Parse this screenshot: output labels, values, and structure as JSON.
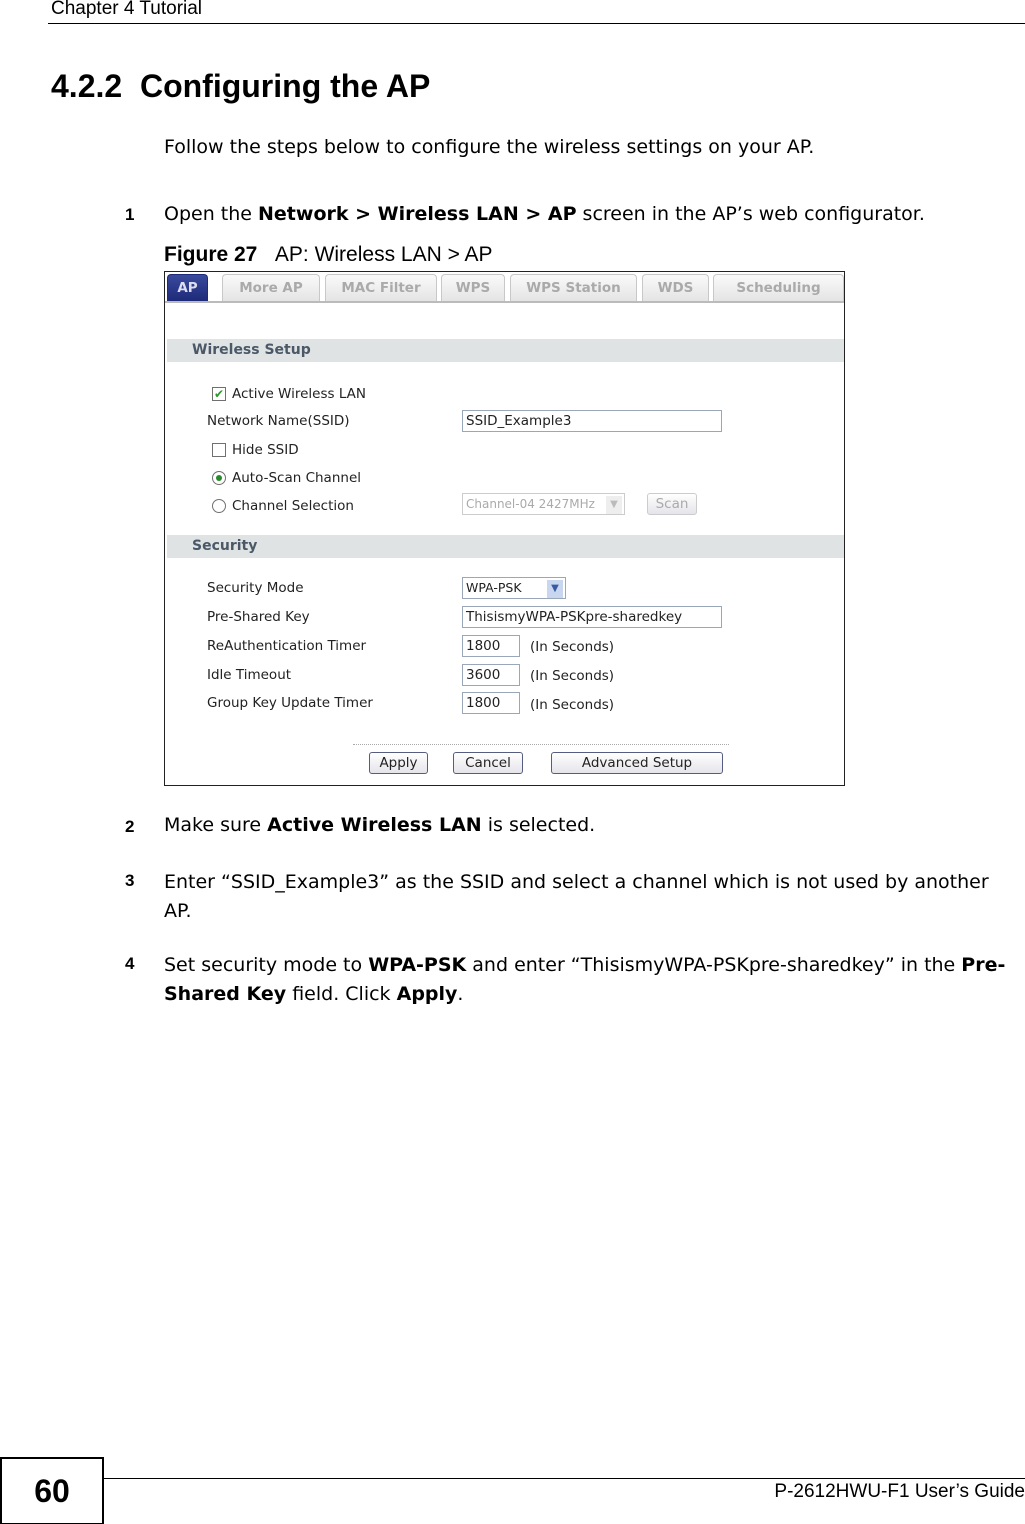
{
  "header": {
    "chapter": "Chapter 4 Tutorial"
  },
  "section": {
    "number": "4.2.2",
    "title": "Configuring the AP"
  },
  "intro": "Follow the steps below to configure the wireless settings on your AP.",
  "steps": [
    {
      "num": "1",
      "parts": [
        "Open the ",
        "Network > Wireless LAN > AP",
        " screen in the AP’s web configurator."
      ]
    },
    {
      "num": "2",
      "parts": [
        "Make sure ",
        "Active Wireless LAN",
        " is selected."
      ]
    },
    {
      "num": "3",
      "text": "Enter “SSID_Example3” as the SSID and select a channel which is not used by another AP."
    },
    {
      "num": "4",
      "parts": [
        "Set security mode to ",
        "WPA-PSK",
        " and enter “ThisismyWPA-PSKpre-sharedkey” in the ",
        "Pre-Shared Key",
        " field. Click ",
        "Apply",
        "."
      ]
    }
  ],
  "figure": {
    "label": "Figure 27",
    "caption": "AP: Wireless LAN > AP"
  },
  "screenshot": {
    "tabs": [
      "AP",
      "More AP",
      "MAC Filter",
      "WPS",
      "WPS Station",
      "WDS",
      "Scheduling"
    ],
    "active_tab": "AP",
    "wireless_setup": {
      "title": "Wireless Setup",
      "active_wireless_lan": {
        "label": "Active Wireless LAN",
        "checked": true
      },
      "ssid": {
        "label": "Network Name(SSID)",
        "value": "SSID_Example3"
      },
      "hide_ssid": {
        "label": "Hide SSID",
        "checked": false
      },
      "auto_scan": {
        "label": "Auto-Scan Channel",
        "selected": true
      },
      "channel_selection": {
        "label": "Channel Selection",
        "selected": false,
        "value": "Channel-04 2427MHz"
      },
      "scan_button": "Scan"
    },
    "security": {
      "title": "Security",
      "mode": {
        "label": "Security Mode",
        "value": "WPA-PSK"
      },
      "psk": {
        "label": "Pre-Shared Key",
        "value": "ThisismyWPA-PSKpre-sharedkey"
      },
      "reauth": {
        "label": "ReAuthentication Timer",
        "value": "1800",
        "unit": "(In Seconds)"
      },
      "idle": {
        "label": "Idle Timeout",
        "value": "3600",
        "unit": "(In Seconds)"
      },
      "groupkey": {
        "label": "Group Key Update Timer",
        "value": "1800",
        "unit": "(In Seconds)"
      }
    },
    "buttons": {
      "apply": "Apply",
      "cancel": "Cancel",
      "advanced": "Advanced Setup"
    },
    "colors": {
      "active_tab": "#1e2a7a",
      "section_bar": "#dfe3e3",
      "check": "#2a9a2a"
    }
  },
  "footer": {
    "page": "60",
    "guide": "P-2612HWU-F1 User’s Guide"
  }
}
